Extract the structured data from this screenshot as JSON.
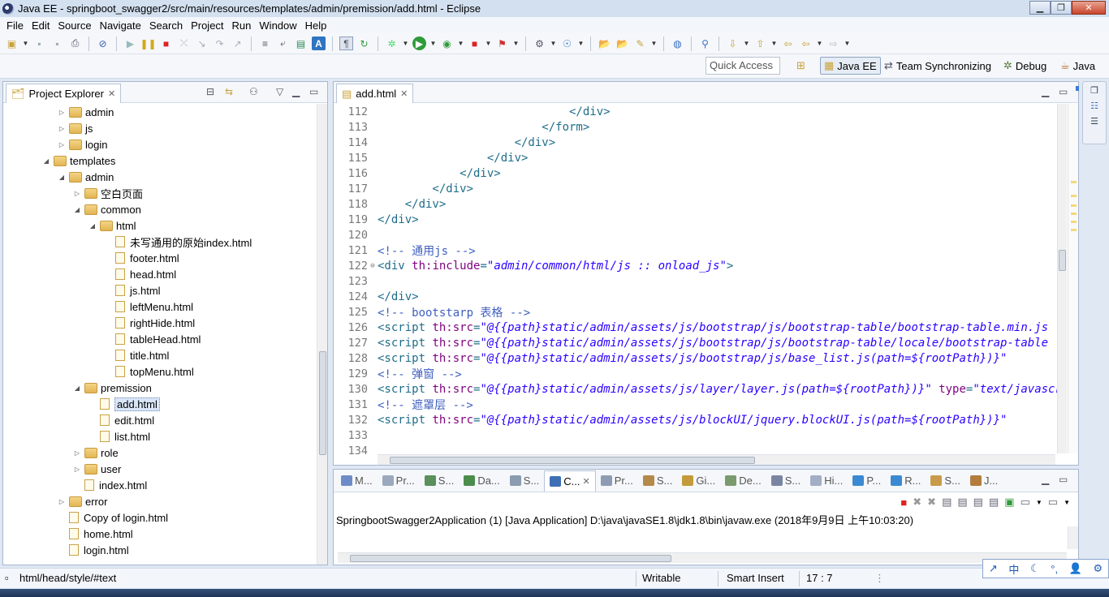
{
  "window": {
    "title": "Java EE - springboot_swagger2/src/main/resources/templates/admin/premission/add.html - Eclipse"
  },
  "menu": [
    "File",
    "Edit",
    "Source",
    "Navigate",
    "Search",
    "Project",
    "Run",
    "Window",
    "Help"
  ],
  "quick_access": "Quick Access",
  "perspectives": [
    "Java EE",
    "Team Synchronizing",
    "Debug",
    "Java"
  ],
  "project_explorer": {
    "title": "Project Explorer",
    "items": [
      {
        "label": "admin",
        "type": "folder",
        "level": 3,
        "expanded": false
      },
      {
        "label": "js",
        "type": "folder",
        "level": 3,
        "expanded": false
      },
      {
        "label": "login",
        "type": "folder",
        "level": 3,
        "expanded": false
      },
      {
        "label": "templates",
        "type": "folder",
        "level": 2,
        "expanded": true
      },
      {
        "label": "admin",
        "type": "folder",
        "level": 3,
        "expanded": true
      },
      {
        "label": "空白页面",
        "type": "folder",
        "level": 4,
        "expanded": false
      },
      {
        "label": "common",
        "type": "folder",
        "level": 4,
        "expanded": true
      },
      {
        "label": "html",
        "type": "folder",
        "level": 5,
        "expanded": true
      },
      {
        "label": "未写通用的原始index.html",
        "type": "file",
        "level": 6
      },
      {
        "label": "footer.html",
        "type": "file",
        "level": 6
      },
      {
        "label": "head.html",
        "type": "file",
        "level": 6
      },
      {
        "label": "js.html",
        "type": "file",
        "level": 6
      },
      {
        "label": "leftMenu.html",
        "type": "file",
        "level": 6
      },
      {
        "label": "rightHide.html",
        "type": "file",
        "level": 6
      },
      {
        "label": "tableHead.html",
        "type": "file",
        "level": 6
      },
      {
        "label": "title.html",
        "type": "file",
        "level": 6
      },
      {
        "label": "topMenu.html",
        "type": "file",
        "level": 6
      },
      {
        "label": "premission",
        "type": "folder",
        "level": 4,
        "expanded": true
      },
      {
        "label": "add.html",
        "type": "file",
        "level": 5,
        "selected": true
      },
      {
        "label": "edit.html",
        "type": "file",
        "level": 5
      },
      {
        "label": "list.html",
        "type": "file",
        "level": 5
      },
      {
        "label": "role",
        "type": "folder",
        "level": 4,
        "expanded": false
      },
      {
        "label": "user",
        "type": "folder",
        "level": 4,
        "expanded": false
      },
      {
        "label": "index.html",
        "type": "file",
        "level": 4
      },
      {
        "label": "error",
        "type": "folder",
        "level": 3,
        "expanded": false
      },
      {
        "label": "Copy of login.html",
        "type": "file",
        "level": 3
      },
      {
        "label": "home.html",
        "type": "file",
        "level": 3
      },
      {
        "label": "login.html",
        "type": "file",
        "level": 3
      }
    ]
  },
  "editor": {
    "tab": "add.html",
    "lines": [
      {
        "n": "112",
        "segs": [
          [
            "t",
            "                            </div>"
          ]
        ]
      },
      {
        "n": "113",
        "segs": [
          [
            "t",
            "                        </form>"
          ]
        ]
      },
      {
        "n": "114",
        "segs": [
          [
            "t",
            "                    </div>"
          ]
        ]
      },
      {
        "n": "115",
        "segs": [
          [
            "t",
            "                </div>"
          ]
        ]
      },
      {
        "n": "116",
        "segs": [
          [
            "t",
            "            </div>"
          ]
        ]
      },
      {
        "n": "117",
        "segs": [
          [
            "t",
            "        </div>"
          ]
        ]
      },
      {
        "n": "118",
        "segs": [
          [
            "t",
            "    </div>"
          ]
        ]
      },
      {
        "n": "119",
        "segs": [
          [
            "t",
            "</div>"
          ]
        ]
      },
      {
        "n": "120",
        "segs": []
      },
      {
        "n": "121",
        "segs": [
          [
            "c",
            "<!-- 通用js -->"
          ]
        ]
      },
      {
        "n": "122",
        "fold": true,
        "segs": [
          [
            "t",
            "<div "
          ],
          [
            "a",
            "th:include"
          ],
          [
            "t",
            "="
          ],
          [
            "s",
            "\"admin/common/html/js :: onload_js\""
          ],
          [
            "t",
            ">"
          ]
        ]
      },
      {
        "n": "123",
        "segs": []
      },
      {
        "n": "124",
        "segs": [
          [
            "t",
            "</div>"
          ]
        ]
      },
      {
        "n": "125",
        "segs": [
          [
            "c",
            "<!-- bootstarp 表格 -->"
          ]
        ]
      },
      {
        "n": "126",
        "segs": [
          [
            "t",
            "<script "
          ],
          [
            "a",
            "th:src"
          ],
          [
            "t",
            "="
          ],
          [
            "s",
            "\"@{{path}static/admin/assets/js/bootstrap/js/bootstrap-table/bootstrap-table.min.js"
          ]
        ]
      },
      {
        "n": "127",
        "segs": [
          [
            "t",
            "<script "
          ],
          [
            "a",
            "th:src"
          ],
          [
            "t",
            "="
          ],
          [
            "s",
            "\"@{{path}static/admin/assets/js/bootstrap/js/bootstrap-table/locale/bootstrap-table"
          ]
        ]
      },
      {
        "n": "128",
        "segs": [
          [
            "t",
            "<script "
          ],
          [
            "a",
            "th:src"
          ],
          [
            "t",
            "="
          ],
          [
            "s",
            "\"@{{path}static/admin/assets/js/bootstrap/js/base_list.js(path=${rootPath})}\""
          ]
        ]
      },
      {
        "n": "129",
        "segs": [
          [
            "c",
            "<!-- 弹窗 -->"
          ]
        ]
      },
      {
        "n": "130",
        "segs": [
          [
            "t",
            "<script "
          ],
          [
            "a",
            "th:src"
          ],
          [
            "t",
            "="
          ],
          [
            "s",
            "\"@{{path}static/admin/assets/js/layer/layer.js(path=${rootPath})}\""
          ],
          [
            "t",
            " "
          ],
          [
            "a",
            "type"
          ],
          [
            "t",
            "="
          ],
          [
            "s",
            "\"text/javascript\""
          ]
        ]
      },
      {
        "n": "131",
        "segs": [
          [
            "c",
            "<!-- 遮罩层 -->"
          ]
        ]
      },
      {
        "n": "132",
        "segs": [
          [
            "t",
            "<script "
          ],
          [
            "a",
            "th:src"
          ],
          [
            "t",
            "="
          ],
          [
            "s",
            "\"@{{path}static/admin/assets/js/blockUI/jquery.blockUI.js(path=${rootPath})}\""
          ]
        ]
      },
      {
        "n": "133",
        "segs": []
      },
      {
        "n": "134",
        "segs": []
      }
    ]
  },
  "console": {
    "tabs": [
      {
        "label": "M...",
        "color": "#6d8cc7"
      },
      {
        "label": "Pr...",
        "color": "#9aa8bd"
      },
      {
        "label": "S...",
        "color": "#5b8f5b"
      },
      {
        "label": "Da...",
        "color": "#4c8c4c"
      },
      {
        "label": "S...",
        "color": "#8b9bb0"
      },
      {
        "label": "C...",
        "color": "#3e6fb5",
        "active": true
      },
      {
        "label": "Pr...",
        "color": "#8d9cb3"
      },
      {
        "label": "S...",
        "color": "#b5894a"
      },
      {
        "label": "Gi...",
        "color": "#c49a3b"
      },
      {
        "label": "De...",
        "color": "#7b9b6e"
      },
      {
        "label": "S...",
        "color": "#7a86a1"
      },
      {
        "label": "Hi...",
        "color": "#a2aec4"
      },
      {
        "label": "P...",
        "color": "#3b8ad1"
      },
      {
        "label": "R...",
        "color": "#3b8ad1"
      },
      {
        "label": "S...",
        "color": "#c89b4b"
      },
      {
        "label": "J...",
        "color": "#b37d3e"
      }
    ],
    "text": "SpringbootSwagger2Application (1) [Java Application] D:\\java\\javaSE1.8\\jdk1.8\\bin\\javaw.exe (2018年9月9日 上午10:03:20)"
  },
  "status": {
    "path": "html/head/style/#text",
    "writable": "Writable",
    "insert_mode": "Smart Insert",
    "position": "17 : 7"
  },
  "ime": [
    "↗",
    "中",
    "☾",
    "°,",
    "👤",
    "⚙"
  ]
}
